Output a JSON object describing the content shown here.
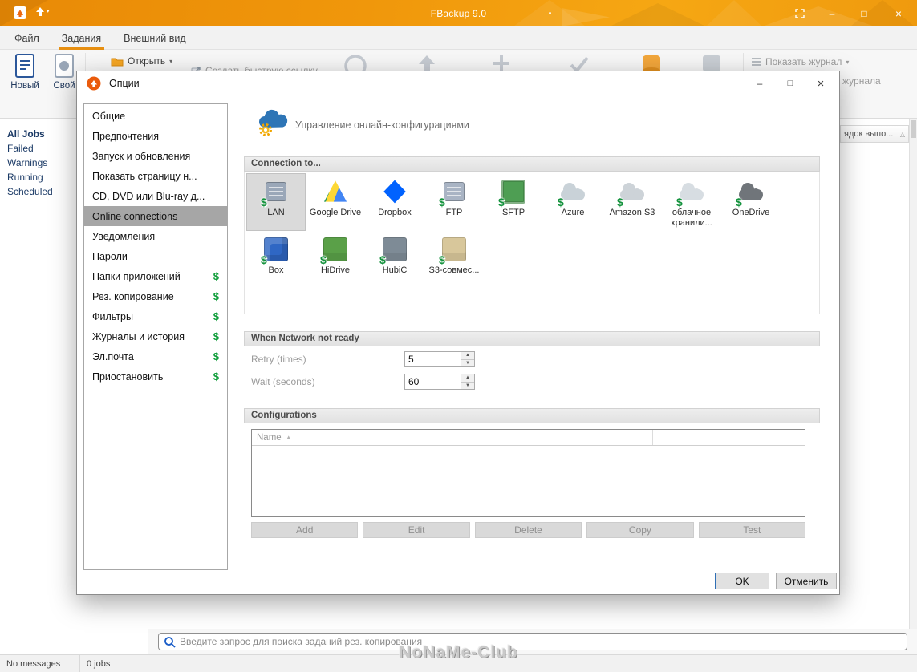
{
  "window": {
    "title": "FBackup 9.0"
  },
  "icons": {
    "dropdown": "▾",
    "dollar": "$",
    "sort_asc": "▲",
    "grid_sort": "△",
    "spin_up": "▲",
    "spin_down": "▼",
    "minimize": "–",
    "maximize": "□",
    "close": "×"
  },
  "menu": {
    "tabs": [
      {
        "label": "Файл"
      },
      {
        "label": "Задания",
        "active": true
      },
      {
        "label": "Внешний вид"
      }
    ]
  },
  "toolbar": {
    "new_label": "Новый",
    "custom_label": "Свой",
    "open_label": "Открыть",
    "quick_link_label": "Создать быструю ссылку...",
    "show_log_label": "Показать журнал",
    "show_log_line2": "журнала",
    "column_header_fragment": "ядок выпо..."
  },
  "sidebar": {
    "items": [
      {
        "label": "All Jobs",
        "bold": true
      },
      {
        "label": "Failed"
      },
      {
        "label": "Warnings"
      },
      {
        "label": "Running"
      },
      {
        "label": "Scheduled"
      }
    ]
  },
  "dialog": {
    "title": "Опции",
    "categories": [
      {
        "label": "Общие"
      },
      {
        "label": "Предпочтения"
      },
      {
        "label": "Запуск и обновления"
      },
      {
        "label": "Показать страницу н..."
      },
      {
        "label": "CD, DVD или Blu-ray д..."
      },
      {
        "label": "Online connections",
        "selected": true
      },
      {
        "label": "Уведомления"
      },
      {
        "label": "Пароли"
      },
      {
        "label": "Папки приложений",
        "dollar": true
      },
      {
        "label": "Рез. копирование",
        "dollar": true
      },
      {
        "label": "Фильтры",
        "dollar": true
      },
      {
        "label": "Журналы и история",
        "dollar": true
      },
      {
        "label": "Эл.почта",
        "dollar": true
      },
      {
        "label": "Приостановить",
        "dollar": true
      }
    ],
    "header_title": "Управление онлайн-конфигурациями",
    "sections": {
      "connection": "Connection to...",
      "network": "When Network not ready",
      "configurations": "Configurations"
    },
    "connections": [
      {
        "label": "LAN",
        "shape": "drive",
        "color": "#9aa7b8",
        "dollar": true,
        "selected": true
      },
      {
        "label": "Google Drive",
        "shape": "triangle",
        "color": "#4285f4"
      },
      {
        "label": "Dropbox",
        "shape": "diamond",
        "color": "#0062ff"
      },
      {
        "label": "FTP",
        "shape": "drive",
        "color": "#a9b4c4",
        "dollar": true
      },
      {
        "label": "SFTP",
        "shape": "terminal",
        "color": "#4e9e53",
        "dollar": true
      },
      {
        "label": "Azure",
        "shape": "cloud",
        "color": "#c9d2d8",
        "dollar": true
      },
      {
        "label": "Amazon S3",
        "shape": "cloud",
        "color": "#cdd3d8",
        "dollar": true
      },
      {
        "label": "облачное хранили...",
        "shape": "cloud",
        "color": "#d7dde2",
        "dollar": true
      },
      {
        "label": "OneDrive",
        "shape": "cloud",
        "color": "#70757a",
        "dollar": true
      },
      {
        "label": "Box",
        "shape": "cube",
        "color": "#2f67c4",
        "dollar": true
      },
      {
        "label": "HiDrive",
        "shape": "square",
        "color": "#5aa048",
        "dollar": true
      },
      {
        "label": "HubiC",
        "shape": "square",
        "color": "#7e8b96",
        "dollar": true
      },
      {
        "label": "S3-совмес...",
        "shape": "square",
        "color": "#d8c79b",
        "dollar": true
      }
    ],
    "network": {
      "retry_label": "Retry (times)",
      "retry_value": "5",
      "wait_label": "Wait (seconds)",
      "wait_value": "60"
    },
    "table": {
      "name_header": "Name"
    },
    "config_buttons": [
      "Add",
      "Edit",
      "Delete",
      "Copy",
      "Test"
    ],
    "ok_label": "OK",
    "cancel_label": "Отменить"
  },
  "search": {
    "placeholder": "Введите запрос для поиска заданий рез. копирования"
  },
  "statusbar": {
    "messages": "No messages",
    "jobs": "0 jobs"
  },
  "watermark": "NoNaMe-Club"
}
